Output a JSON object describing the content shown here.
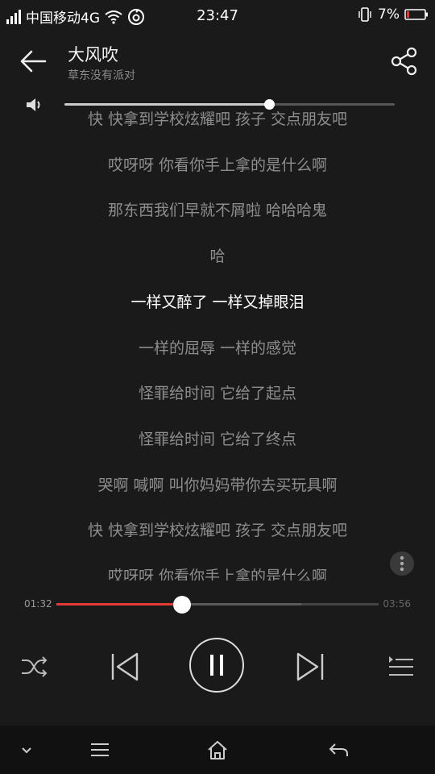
{
  "status_bar": {
    "carrier": "中国移动4G",
    "time": "23:47",
    "battery": "7%",
    "icons": [
      "signal-icon",
      "wifi-icon",
      "netease-icon",
      "vibrate-icon",
      "battery-icon"
    ]
  },
  "header": {
    "song_title": "大风吹",
    "artist": "草东没有派对",
    "icons": [
      "back-arrow-icon",
      "share-icon"
    ]
  },
  "volume": {
    "level": 0.62,
    "icon": "speaker-icon"
  },
  "lyrics": {
    "active_index": 4,
    "lines": [
      "快 快拿到学校炫耀吧 孩子 交点朋友吧",
      "哎呀呀 你看你手上拿的是什么啊",
      "那东西我们早就不屑啦 哈哈哈鬼",
      "哈",
      "一样又醉了 一样又掉眼泪",
      "一样的屈辱 一样的感觉",
      "怪罪给时间 它给了起点",
      "怪罪给时间 它给了终点",
      "哭啊 喊啊 叫你妈妈带你去买玩具啊",
      "快 快拿到学校炫耀吧 孩子 交点朋友吧",
      "哎呀呀 你看你手上拿的是什么啊"
    ]
  },
  "more_button": {
    "icon": "more-vertical-icon"
  },
  "playback": {
    "current_time": "01:32",
    "total_time": "03:56",
    "progress": 0.39,
    "buffered": 0.76
  },
  "controls": {
    "icons": [
      "shuffle-icon",
      "previous-icon",
      "pause-icon",
      "next-icon",
      "playlist-icon"
    ]
  },
  "nav_bar": {
    "icons": [
      "chevron-down-icon",
      "menu-icon",
      "home-icon",
      "return-icon"
    ]
  },
  "colors": {
    "background": "#1a1a1a",
    "accent": "#e53935",
    "lyric_active": "#ffffff",
    "lyric_inactive": "#8d8d8d"
  }
}
